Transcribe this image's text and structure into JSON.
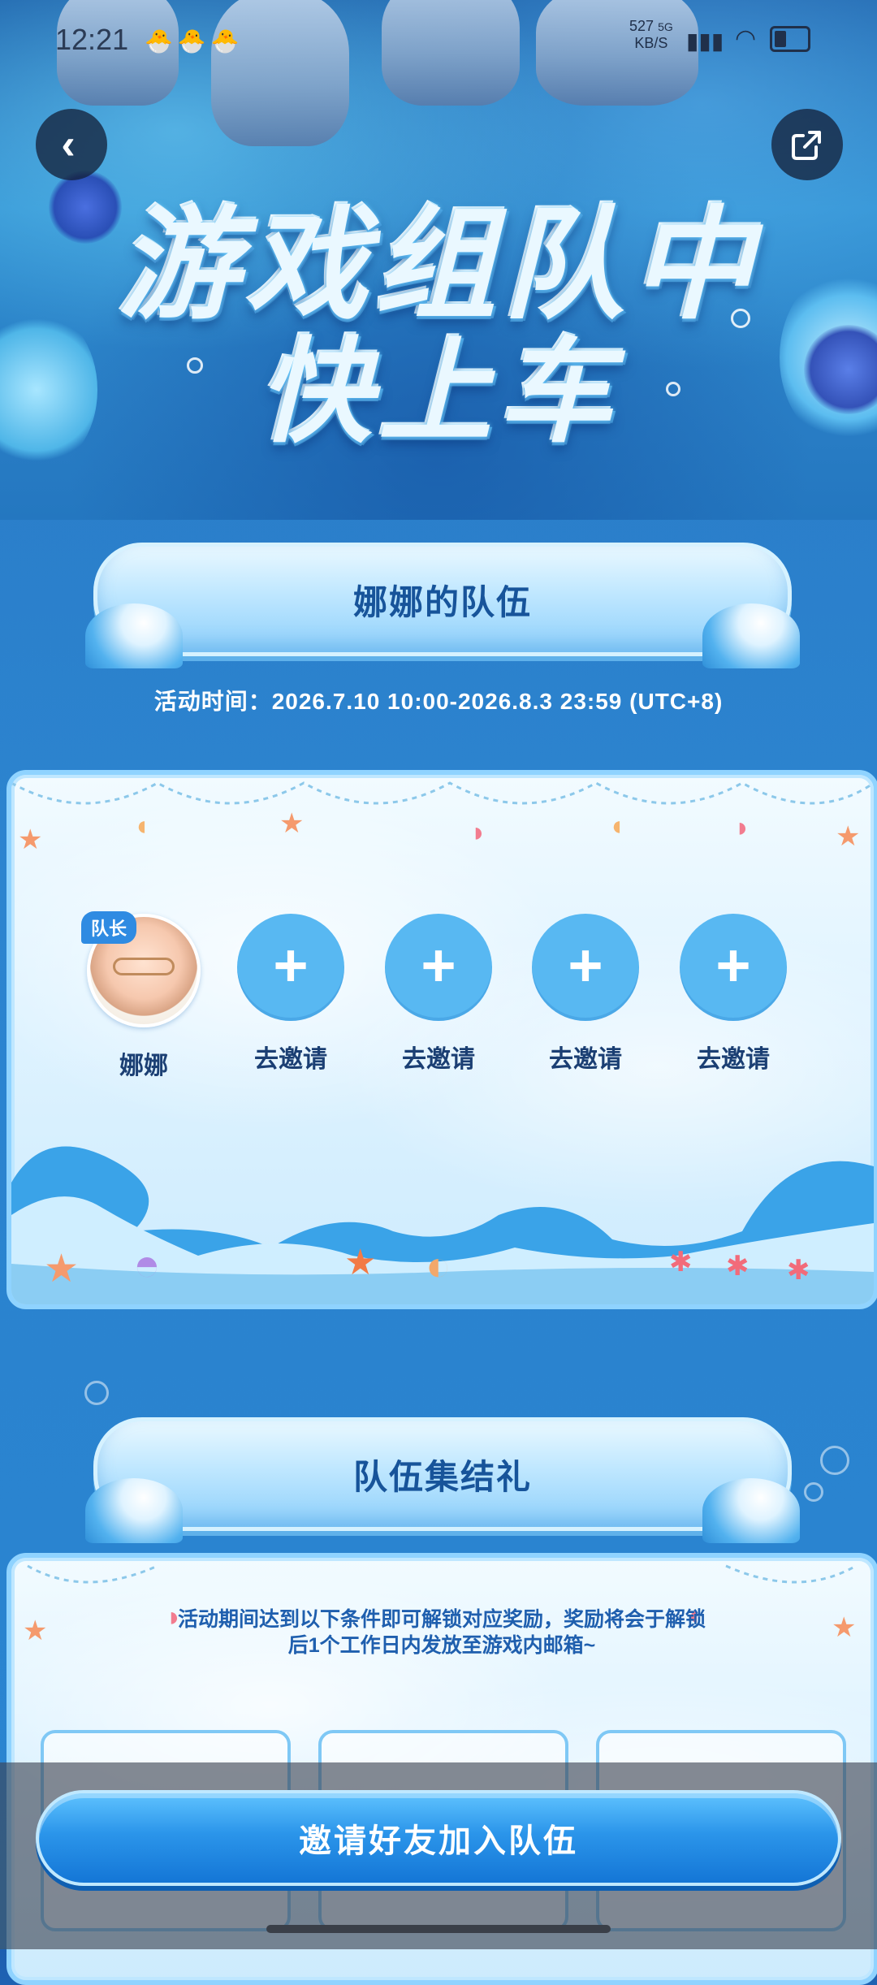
{
  "status_bar": {
    "time": "12:21",
    "notification_icons": "🐣🐣🐣",
    "net_speed": "527",
    "net_unit": "KB/S",
    "net_type": "5G"
  },
  "banner": {
    "title_line1": "游戏组队中",
    "title_line2": "快上车"
  },
  "team": {
    "header": "娜娜的队伍",
    "activity_time": "活动时间：2026.7.10 10:00-2026.8.3 23:59 (UTC+8)",
    "captain_tag": "队长",
    "members": [
      {
        "name": "娜娜",
        "type": "captain"
      },
      {
        "name": "去邀请",
        "type": "invite"
      },
      {
        "name": "去邀请",
        "type": "invite"
      },
      {
        "name": "去邀请",
        "type": "invite"
      },
      {
        "name": "去邀请",
        "type": "invite"
      }
    ],
    "plus_symbol": "+"
  },
  "rewards": {
    "header": "队伍集结礼",
    "description": "活动期间达到以下条件即可解锁对应奖励，奖励将会于解锁后1个工作日内发放至游戏内邮箱~"
  },
  "bottom": {
    "invite_button": "邀请好友加入队伍"
  },
  "icons": {
    "back": "chevron-left-icon",
    "share": "share-icon"
  },
  "colors": {
    "primary_blue": "#2b95ea",
    "title_text": "#17549a",
    "plus_circle": "#58b8f2"
  }
}
